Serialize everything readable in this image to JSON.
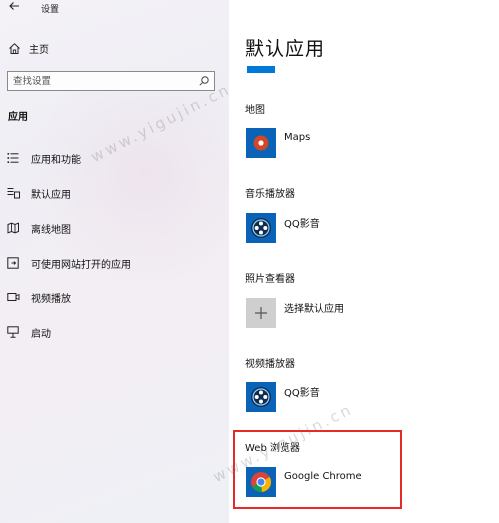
{
  "window": {
    "title": "设置",
    "back_icon": "arrow-left-icon"
  },
  "sidebar": {
    "home_label": "主页",
    "search_placeholder": "查找设置",
    "section_title": "应用",
    "items": [
      {
        "label": "应用和功能",
        "icon": "list-icon"
      },
      {
        "label": "默认应用",
        "icon": "default-apps-icon",
        "active": true
      },
      {
        "label": "离线地图",
        "icon": "offline-map-icon"
      },
      {
        "label": "可使用网站打开的应用",
        "icon": "web-open-icon"
      },
      {
        "label": "视频播放",
        "icon": "video-icon"
      },
      {
        "label": "启动",
        "icon": "startup-icon"
      }
    ]
  },
  "main": {
    "title": "默认应用",
    "accent_color": "#0078d7",
    "sections": [
      {
        "category": "地图",
        "app": "Maps",
        "icon": "maps-icon"
      },
      {
        "category": "音乐播放器",
        "app": "QQ影音",
        "icon": "qq-player-icon"
      },
      {
        "category": "照片查看器",
        "app": "选择默认应用",
        "icon": "plus-icon"
      },
      {
        "category": "视频播放器",
        "app": "QQ影音",
        "icon": "qq-player-icon"
      },
      {
        "category": "Web 浏览器",
        "app": "Google Chrome",
        "icon": "chrome-icon"
      }
    ],
    "highlight_color": "#e52a27"
  },
  "watermark": "www.yigujin.cn"
}
